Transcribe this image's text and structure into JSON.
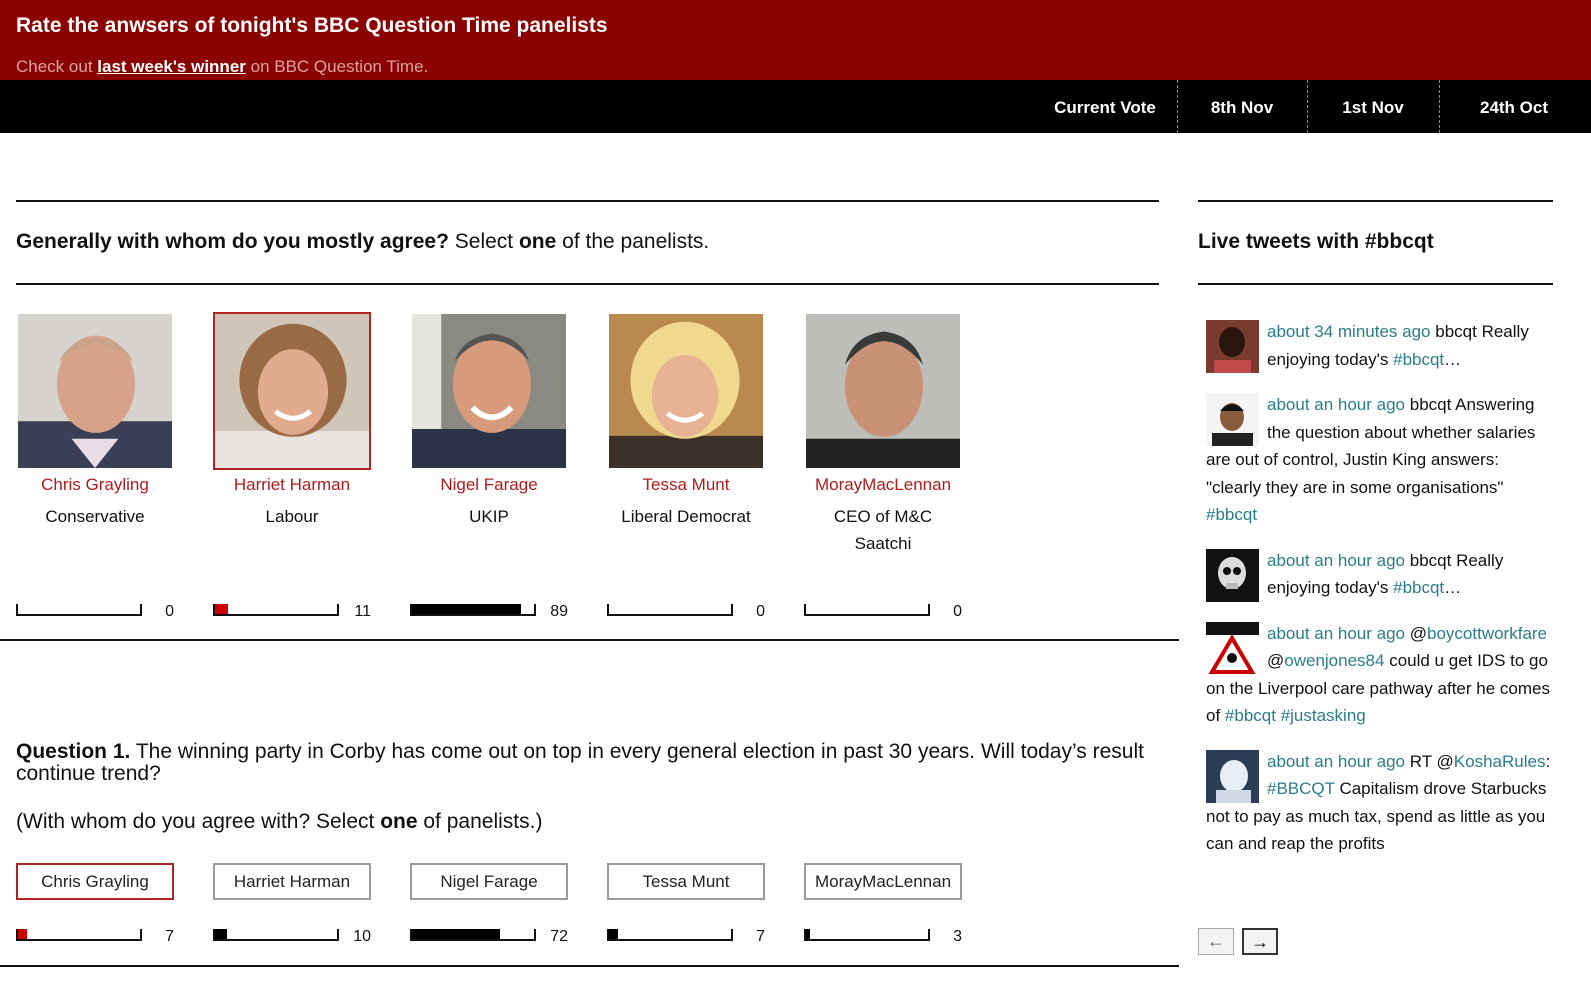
{
  "header": {
    "title": "Rate the anwsers of tonight's BBC Question Time panelists",
    "sub_prefix": "Check out",
    "sub_link": "last week's winner",
    "sub_suffix": "on BBC Question Time."
  },
  "nav": [
    "Current Vote",
    "8th Nov",
    "1st Nov",
    "24th Oct"
  ],
  "general": {
    "q_bold": "Generally with whom do you mostly agree?",
    "q_pre": "Select",
    "q_one": "one",
    "q_post": "of the panelists."
  },
  "panelists": [
    {
      "name": "Chris Grayling",
      "party": "Conservative",
      "selected": false
    },
    {
      "name": "Harriet Harman",
      "party": "Labour",
      "selected": true
    },
    {
      "name": "Nigel Farage",
      "party": "UKIP",
      "selected": false
    },
    {
      "name": "Tessa Munt",
      "party": "Liberal Democrat",
      "selected": false
    },
    {
      "name": "MorayMacLennan",
      "party": "CEO of M&C Saatchi",
      "selected": false
    }
  ],
  "general_votes": [
    {
      "count": "0",
      "fraction": 0,
      "color": "#000000"
    },
    {
      "count": "11",
      "fraction": 0.11,
      "color": "#cc0000"
    },
    {
      "count": "89",
      "fraction": 0.89,
      "color": "#000000"
    },
    {
      "count": "0",
      "fraction": 0,
      "color": "#000000"
    },
    {
      "count": "0",
      "fraction": 0,
      "color": "#000000"
    }
  ],
  "question1": {
    "label": "Question 1.",
    "text": "The winning party in Corby has come out on top in every general election in past 30 years. Will today’s result continue trend?",
    "sub_pre": "(With whom do you agree with? Select",
    "sub_one": "one",
    "sub_post": "of panelists.)",
    "buttons": [
      {
        "label": "Chris Grayling",
        "selected": true
      },
      {
        "label": "Harriet Harman",
        "selected": false
      },
      {
        "label": "Nigel Farage",
        "selected": false
      },
      {
        "label": "Tessa Munt",
        "selected": false
      },
      {
        "label": "MorayMacLennan",
        "selected": false
      }
    ],
    "votes": [
      {
        "count": "7",
        "fraction": 0.07,
        "color": "#cc0000"
      },
      {
        "count": "10",
        "fraction": 0.1,
        "color": "#000000"
      },
      {
        "count": "72",
        "fraction": 0.72,
        "color": "#000000"
      },
      {
        "count": "7",
        "fraction": 0.07,
        "color": "#000000"
      },
      {
        "count": "3",
        "fraction": 0.03,
        "color": "#000000"
      }
    ]
  },
  "tweets_title": "Live tweets with #bbcqt",
  "tweets": [
    {
      "time": "about 34 minutes ago",
      "user": "bbcqt",
      "parts": [
        {
          "t": "Really enjoying today's "
        },
        {
          "l": "#bbcqt"
        },
        {
          "t": "…"
        }
      ]
    },
    {
      "time": "about an hour ago",
      "user": "bbcqt",
      "parts": [
        {
          "t": "Answering the question about whether salaries are out of control, Justin King answers: \"clearly they are in some organisations\" "
        },
        {
          "l": "#bbcqt"
        }
      ]
    },
    {
      "time": "about an hour ago",
      "user": "bbcqt",
      "parts": [
        {
          "t": "Really enjoying today's "
        },
        {
          "l": "#bbcqt"
        },
        {
          "t": "…"
        }
      ]
    },
    {
      "time": "about an hour ago",
      "user": "",
      "parts": [
        {
          "t": "@"
        },
        {
          "l": "boycottworkfare"
        },
        {
          "t": " @"
        },
        {
          "l": "owenjones84"
        },
        {
          "t": " could u get IDS to go on the Liverpool care pathway after he comes of "
        },
        {
          "l": "#bbcqt"
        },
        {
          "t": " "
        },
        {
          "l": "#justasking"
        }
      ]
    },
    {
      "time": "about an hour ago",
      "user": "RT",
      "parts": [
        {
          "t": "@"
        },
        {
          "l": "KoshaRules"
        },
        {
          "t": ": "
        },
        {
          "l": "#BBCQT"
        },
        {
          "t": " Capitalism drove Starbucks not to pay as much tax, spend as little as you can and reap the profits"
        }
      ]
    }
  ],
  "pager": {
    "prev": "←",
    "next": "→"
  }
}
